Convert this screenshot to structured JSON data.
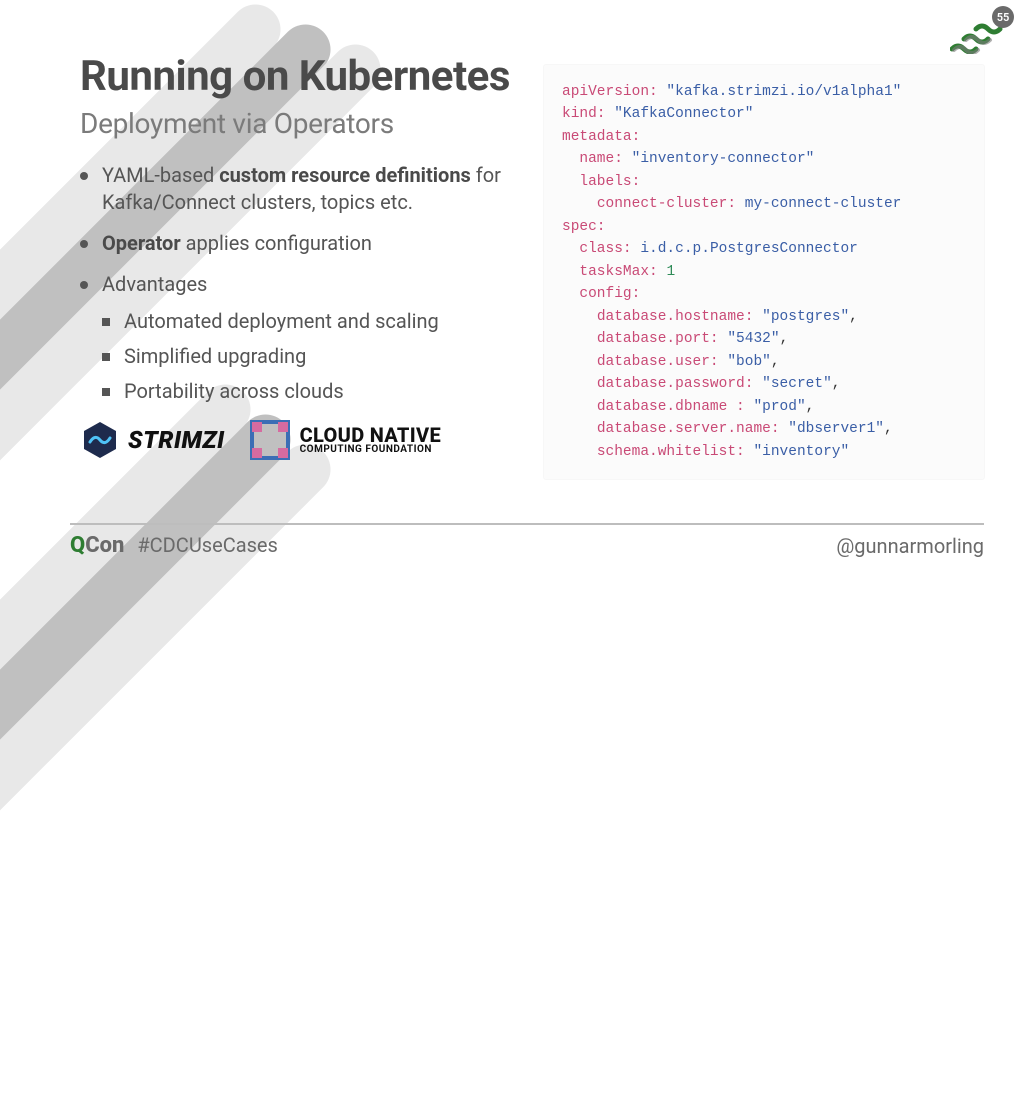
{
  "pageNumber": "55",
  "title": "Running on Kubernetes",
  "subtitle": "Deployment via Operators",
  "bullets": {
    "b1_pre": "YAML-based ",
    "b1_bold": "custom resource definitions",
    "b1_post": " for Kafka/Connect clusters, topics etc.",
    "b2_bold": "Operator",
    "b2_post": " applies configuration",
    "b3": "Advantages",
    "b3s1": "Automated deployment and scaling",
    "b3s2": "Simplified upgrading",
    "b3s3": "Portability across clouds"
  },
  "logos": {
    "strimzi": "STRIMZI",
    "cncf_l1": "CLOUD NATIVE",
    "cncf_l2": "COMPUTING FOUNDATION"
  },
  "yaml": {
    "apiVersion_k": "apiVersion:",
    "apiVersion_v": "\"kafka.strimzi.io/v1alpha1\"",
    "kind_k": "kind:",
    "kind_v": "\"KafkaConnector\"",
    "metadata_k": "metadata:",
    "name_k": "name:",
    "name_v": "\"inventory-connector\"",
    "labels_k": "labels:",
    "connectCluster_k": "connect-cluster:",
    "connectCluster_v": "my-connect-cluster",
    "spec_k": "spec:",
    "class_k": "class:",
    "class_v": "i.d.c.p.PostgresConnector",
    "tasksMax_k": "tasksMax:",
    "tasksMax_v": "1",
    "config_k": "config:",
    "cfg_hostname_k": "database.hostname:",
    "cfg_hostname_v": "\"postgres\"",
    "cfg_port_k": "database.port:",
    "cfg_port_v": "\"5432\"",
    "cfg_user_k": "database.user:",
    "cfg_user_v": "\"bob\"",
    "cfg_password_k": "database.password:",
    "cfg_password_v": "\"secret\"",
    "cfg_dbname_k": "database.dbname :",
    "cfg_dbname_v": "\"prod\"",
    "cfg_servername_k": "database.server.name:",
    "cfg_servername_v": "\"dbserver1\"",
    "cfg_whitelist_k": "schema.whitelist:",
    "cfg_whitelist_v": "\"inventory\"",
    "comma": ","
  },
  "footer": {
    "qcon_q": "Q",
    "qcon_con": "Con",
    "hashtag": "#CDCUseCases",
    "handle": "@gunnarmorling"
  }
}
